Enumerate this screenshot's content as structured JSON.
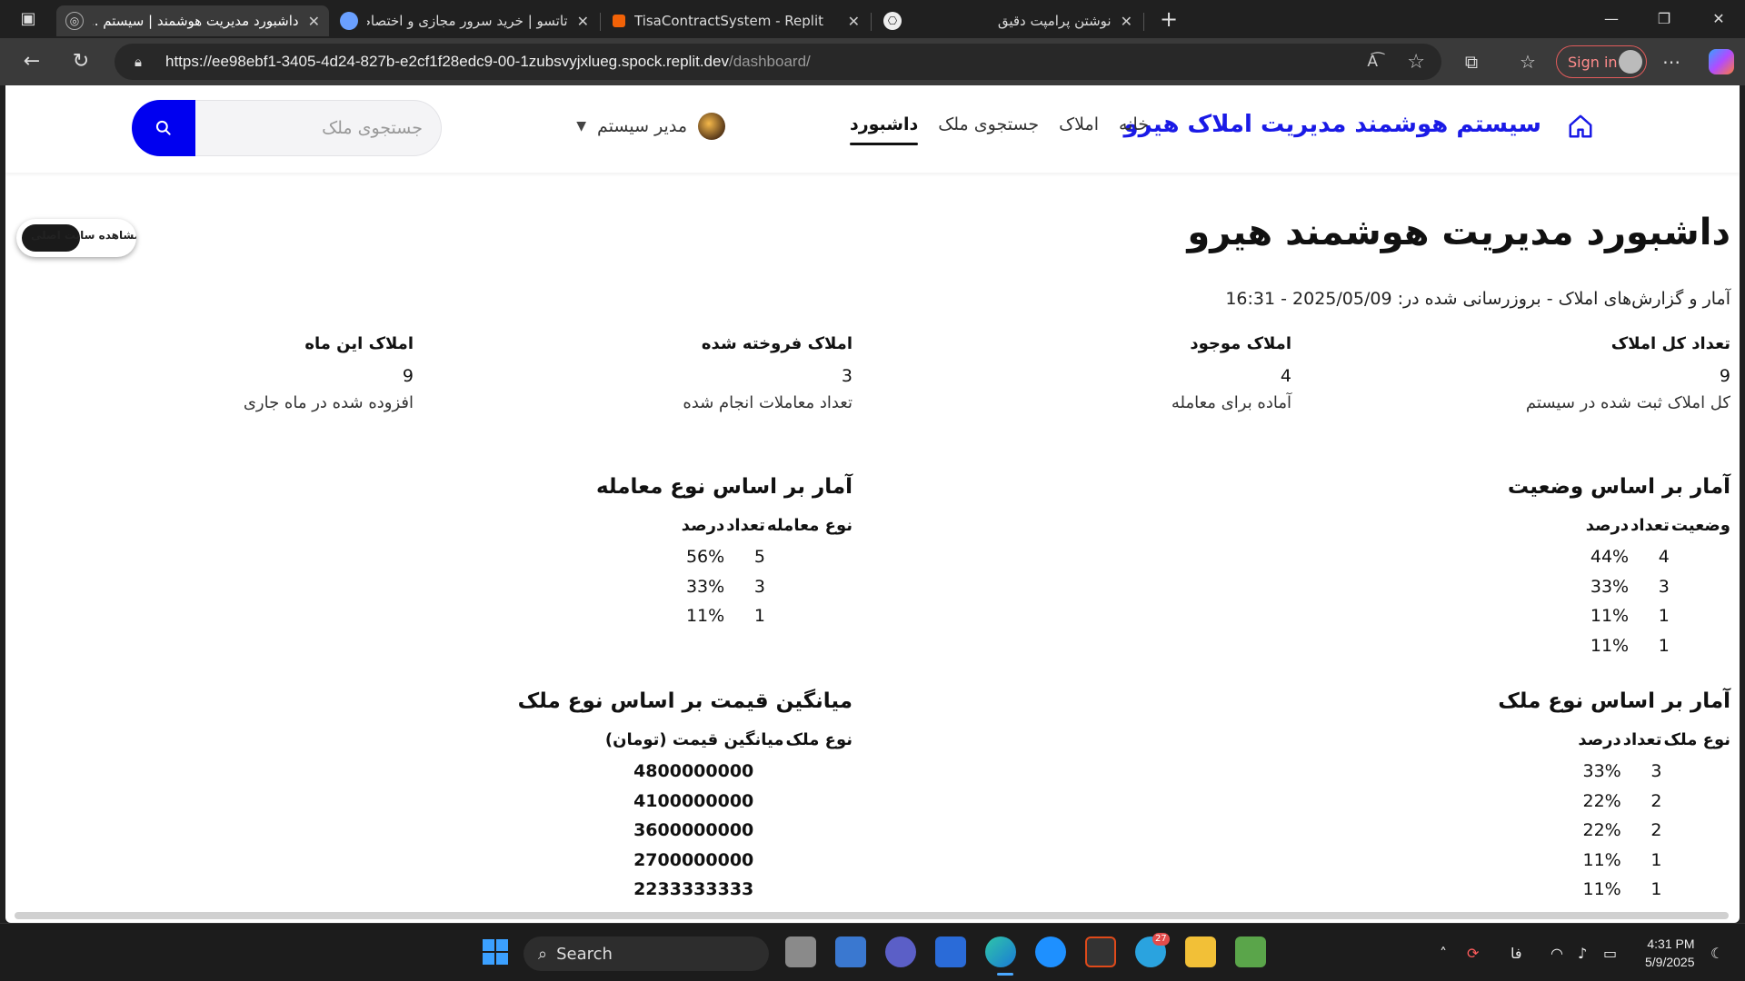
{
  "browser": {
    "tabs": [
      {
        "title": "داشبورد مدیریت هوشمند | سیستم ...",
        "active": true
      },
      {
        "title": "تاتسو | خرید سرور مجازی و اختصاص...",
        "active": false
      },
      {
        "title": "TisaContractSystem - Replit",
        "active": false
      },
      {
        "title": "نوشتن پرامپت دقیق",
        "active": false
      }
    ],
    "url_main": "https://ee98ebf1-3405-4d24-827b-e2cf1f28edc9-00-1zubsvyjxlueg.spock.replit.dev",
    "url_path": "/dashboard/",
    "signin_label": "Sign in"
  },
  "site": {
    "brand": "سیستم هوشمند مدیریت املاک هیرو",
    "menu": [
      {
        "label": "خانه",
        "active": false
      },
      {
        "label": "املاک",
        "active": false
      },
      {
        "label": "جستجوی ملک",
        "active": false
      },
      {
        "label": "داشبورد",
        "active": true
      }
    ],
    "user_name": "مدیر سیستم",
    "search_placeholder": "جستجوی ملک",
    "float_pill_text": "مشاهده سایت اصلی",
    "accent_color": "#0000f0"
  },
  "dashboard": {
    "title": "داشبورد مدیریت هوشمند هیرو",
    "subtitle": "آمار و گزارش‌های املاک - بروزرسانی شده در: 2025/05/09 - 16:31",
    "cards": [
      {
        "label": "تعداد کل املاک",
        "value": "9",
        "desc": "کل املاک ثبت شده در سیستم"
      },
      {
        "label": "املاک موجود",
        "value": "4",
        "desc": "آماده برای معامله"
      },
      {
        "label": "املاک فروخته شده",
        "value": "3",
        "desc": "تعداد معاملات انجام شده"
      },
      {
        "label": "املاک این ماه",
        "value": "9",
        "desc": "افزوده شده در ماه جاری"
      }
    ],
    "status_stats": {
      "title": "آمار بر اساس وضعیت",
      "headers": [
        "وضعیت",
        "تعداد",
        "درصد"
      ],
      "rows": [
        {
          "label": "",
          "count": "4",
          "pct": "44%"
        },
        {
          "label": "",
          "count": "3",
          "pct": "33%"
        },
        {
          "label": "",
          "count": "1",
          "pct": "11%"
        },
        {
          "label": "",
          "count": "1",
          "pct": "11%"
        }
      ]
    },
    "deal_stats": {
      "title": "آمار بر اساس نوع معامله",
      "headers": [
        "نوع معامله",
        "تعداد",
        "درصد"
      ],
      "rows": [
        {
          "label": "",
          "count": "5",
          "pct": "56%"
        },
        {
          "label": "",
          "count": "3",
          "pct": "33%"
        },
        {
          "label": "",
          "count": "1",
          "pct": "11%"
        }
      ]
    },
    "type_stats": {
      "title": "آمار بر اساس نوع ملک",
      "headers": [
        "نوع ملک",
        "تعداد",
        "درصد"
      ],
      "rows": [
        {
          "label": "",
          "count": "3",
          "pct": "33%"
        },
        {
          "label": "",
          "count": "2",
          "pct": "22%"
        },
        {
          "label": "",
          "count": "2",
          "pct": "22%"
        },
        {
          "label": "",
          "count": "1",
          "pct": "11%"
        },
        {
          "label": "",
          "count": "1",
          "pct": "11%"
        }
      ]
    },
    "price_stats": {
      "title": "میانگین قیمت بر اساس نوع ملک",
      "headers": [
        "نوع ملک",
        "میانگین قیمت (تومان)"
      ],
      "rows": [
        {
          "label": "",
          "price": "4800000000"
        },
        {
          "label": "",
          "price": "4100000000"
        },
        {
          "label": "",
          "price": "3600000000"
        },
        {
          "label": "",
          "price": "2700000000"
        },
        {
          "label": "",
          "price": "2233333333"
        }
      ]
    }
  },
  "taskbar": {
    "search_label": "Search",
    "telegram_badge": "27",
    "lang": "فا",
    "time": "4:31 PM",
    "date": "5/9/2025"
  }
}
